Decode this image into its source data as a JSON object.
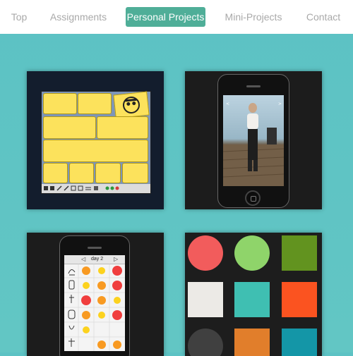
{
  "nav": {
    "items": [
      {
        "label": "Top"
      },
      {
        "label": "Assignments"
      },
      {
        "label": "Personal Projects"
      },
      {
        "label": "Mini-Projects"
      },
      {
        "label": "Contact"
      }
    ],
    "active_index": 2
  },
  "projects": {
    "planner_app": {
      "icons": [
        "face-icon",
        "toolbar-icons"
      ]
    },
    "fashion_app": {
      "icons": [
        "model-photo"
      ]
    },
    "habit_tracker": {
      "header_label": "day 2",
      "icons": [
        "back-arrow-icon",
        "forward-arrow-icon",
        "exercise-icons"
      ]
    },
    "palette": {
      "colors": [
        "#f25c5c",
        "#8fd46a",
        "#62931f",
        "#eceae6",
        "#3fbfb2",
        "#fb5320",
        "#404040",
        "#e17e2b",
        "#1496a7"
      ]
    }
  },
  "colors": {
    "accent": "#4fae98",
    "background": "#5cc2c4",
    "nav_text": "#a9a9a9",
    "tile_dark": "#1c1c1c"
  }
}
